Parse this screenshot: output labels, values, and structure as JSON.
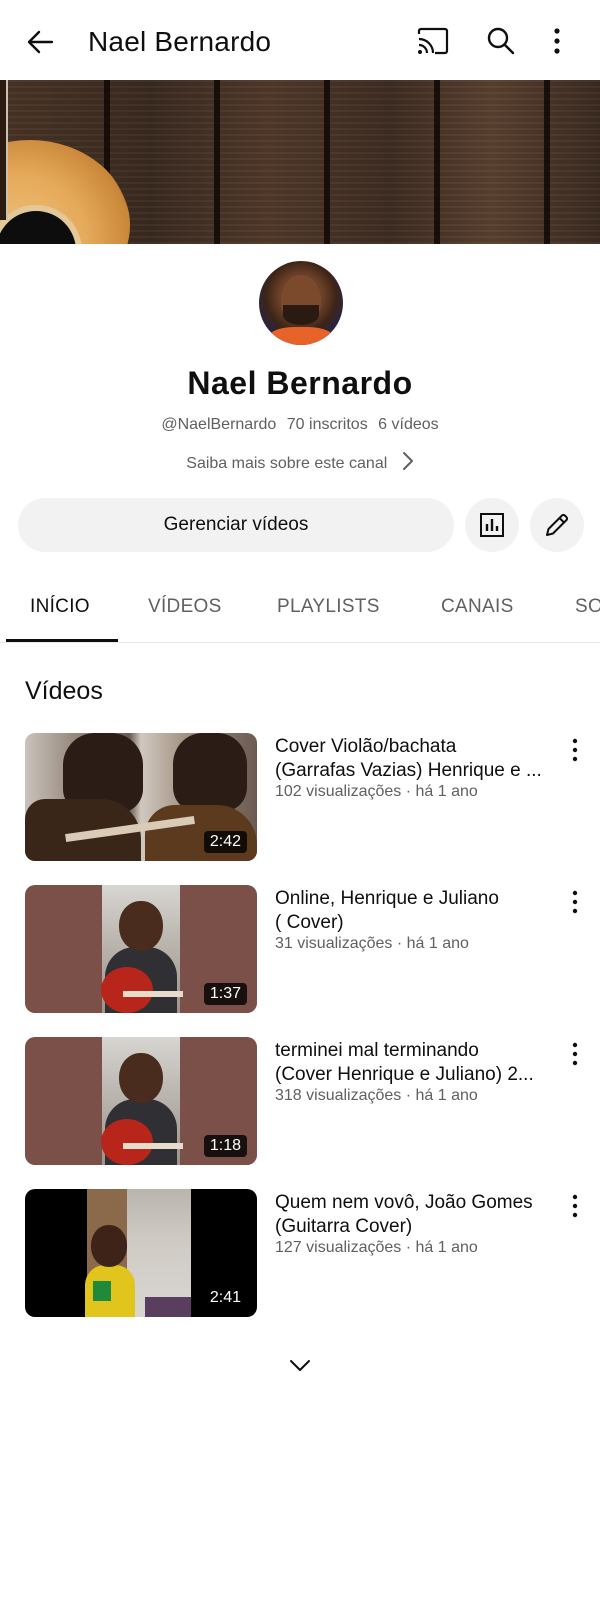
{
  "topbar": {
    "title": "Nael Bernardo",
    "icons": [
      "back-arrow-icon",
      "cast-icon",
      "search-icon",
      "more-vert-icon"
    ]
  },
  "channel": {
    "name": "Nael Bernardo",
    "handle": "@NaelBernardo",
    "subscribers": "70 inscritos",
    "videos_count": "6 vídeos",
    "about_link": "Saiba mais sobre este canal"
  },
  "actions": {
    "manage_label": "Gerenciar vídeos",
    "stats_icon": "bar-chart-icon",
    "edit_icon": "pencil-icon"
  },
  "tabs": [
    {
      "label": "INÍCIO",
      "active": true
    },
    {
      "label": "VÍDEOS",
      "active": false
    },
    {
      "label": "PLAYLISTS",
      "active": false
    },
    {
      "label": "CANAIS",
      "active": false
    },
    {
      "label": "SO",
      "active": false
    }
  ],
  "section": {
    "title": "Vídeos"
  },
  "videos": [
    {
      "title_line1": "Cover Violão/bachata",
      "title_line2": "(Garrafas Vazias) Henrique e ...",
      "meta": "102 visualizações · há 1 ano",
      "duration": "2:42"
    },
    {
      "title_line1": "Online, Henrique e Juliano",
      "title_line2": "( Cover)",
      "meta": "31 visualizações · há 1 ano",
      "duration": "1:37"
    },
    {
      "title_line1": "terminei mal terminando",
      "title_line2": "(Cover Henrique e Juliano) 2...",
      "meta": "318 visualizações · há 1 ano",
      "duration": "1:18"
    },
    {
      "title_line1": "Quem nem vovô, João Gomes",
      "title_line2": "(Guitarra Cover)",
      "meta": "127 visualizações · há 1 ano",
      "duration": "2:41"
    }
  ],
  "colors": {
    "text_primary": "#0f0f0f",
    "text_secondary": "#606060",
    "button_bg": "#f2f2f2",
    "divider": "#e5e5e5"
  }
}
